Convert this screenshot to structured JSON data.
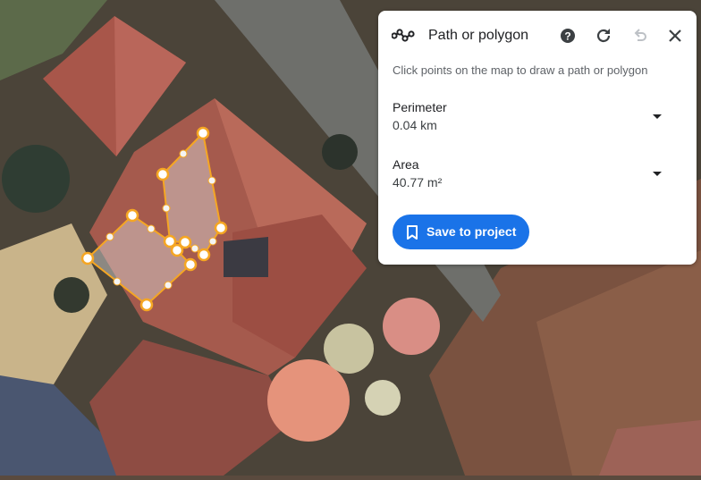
{
  "tool": {
    "title": "Path or polygon",
    "instruction": "Click points on the map to draw a path or polygon",
    "icons": {
      "tool": "path-polygon-icon",
      "help": "help-icon",
      "refresh": "refresh-icon",
      "undo": "undo-icon",
      "close": "close-icon"
    }
  },
  "measurements": {
    "perimeter": {
      "label": "Perimeter",
      "value": "0.04 km"
    },
    "area": {
      "label": "Area",
      "value": "40.77 m²"
    }
  },
  "save_button": {
    "label": "Save to project",
    "icon": "bookmark-icon"
  },
  "colors": {
    "accent": "#1a73e8",
    "polygon_stroke": "#f5a623",
    "vertex_fill": "#ffffff",
    "roof": "#a9574c",
    "panel_bg": "#ffffff"
  }
}
